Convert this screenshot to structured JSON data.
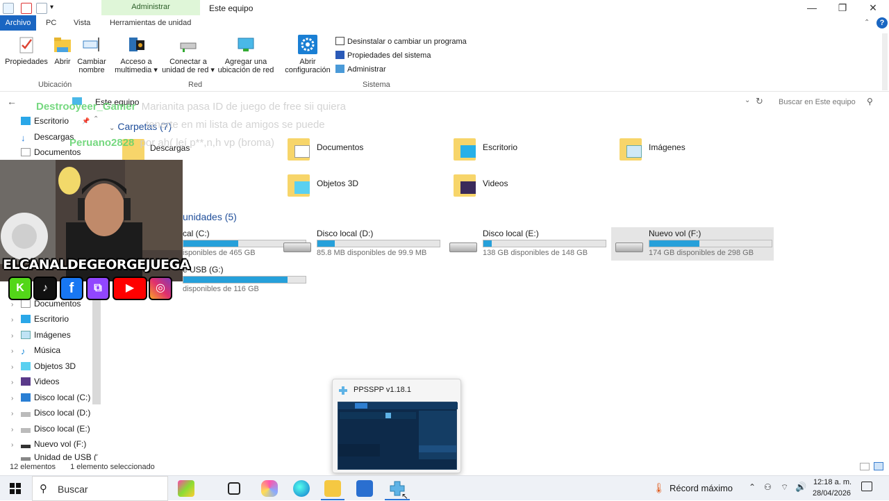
{
  "titlebar": {
    "context_tab": "Administrar",
    "window_title": "Este equipo",
    "buttons": [
      "—",
      "❐",
      "✕"
    ]
  },
  "tabs": {
    "file": "Archivo",
    "items": [
      "PC",
      "Vista",
      "Herramientas de unidad"
    ],
    "help": "?"
  },
  "ribbon": {
    "buttons": {
      "propiedades": "Propiedades",
      "abrir": "Abrir",
      "cambiar_nombre_1": "Cambiar",
      "cambiar_nombre_2": "nombre",
      "acceso_1": "Acceso a",
      "acceso_2": "multimedia ▾",
      "conectar_1": "Conectar a",
      "conectar_2": "unidad de red ▾",
      "agregar_1": "Agregar una",
      "agregar_2": "ubicación de red",
      "config_1": "Abrir",
      "config_2": "configuración"
    },
    "system_items": [
      "Desinstalar o cambiar un programa",
      "Propiedades del sistema",
      "Administrar"
    ],
    "groups": [
      "Ubicación",
      "Red",
      "Sistema"
    ]
  },
  "address": {
    "path": "Este equipo",
    "search_placeholder": "Buscar en Este equipo"
  },
  "nav": {
    "quick": [
      "Escritorio",
      "Descargas",
      "Documentos"
    ],
    "tree": [
      "Documentos",
      "Escritorio",
      "Imágenes",
      "Música",
      "Objetos 3D",
      "Videos",
      "Disco local (C:)",
      "Disco local (D:)",
      "Disco local (E:)",
      "Nuevo vol (F:)",
      "Unidad de USB ("
    ]
  },
  "content": {
    "folders_header": "Carpetas (7)",
    "folders": [
      "Descargas",
      "Documentos",
      "Escritorio",
      "Imágenes",
      "Objetos 3D",
      "Videos"
    ],
    "drives_header": "unidades (5)",
    "drives": [
      {
        "name": "cal (C:)",
        "free": "isponibles de 465 GB",
        "used": 0.45
      },
      {
        "name": "Disco local (D:)",
        "free": "85.8 MB disponibles de 99.9 MB",
        "used": 0.14
      },
      {
        "name": "Disco local (E:)",
        "free": "138 GB disponibles de 148 GB",
        "used": 0.07
      },
      {
        "name": "Nuevo vol (F:)",
        "free": "174 GB disponibles de 298 GB",
        "used": 0.41
      },
      {
        "name": "e USB (G:)",
        "free": "disponibles de 116 GB",
        "used": 0.85
      }
    ]
  },
  "status": {
    "count": "12 elementos",
    "selected": "1 elemento seleccionado"
  },
  "preview": {
    "title": "PPSSPP v1.18.1"
  },
  "taskbar": {
    "search": "Buscar",
    "weather": "Récord máximo",
    "time": "12:18 a. m.",
    "date": "28/04/2026"
  },
  "stream": {
    "channel": "ELCANALDEGEORGEJUEGA",
    "social": [
      "K",
      "♪",
      "f",
      "⧉",
      "▶",
      "◎"
    ],
    "chat": [
      {
        "user": "Destrooyeer_Gamer",
        "msg": "Marianita pasa ID de juego de free sii quiera"
      },
      {
        "user": "",
        "msg": "tenerte en mi lista de amigos se puede"
      },
      {
        "user": "Peruano2828",
        "msg": "por ah( leí p**,n,h vp (broma)"
      }
    ]
  },
  "colors": {
    "accent": "#1a66c2",
    "drive_fill": "#26a0da",
    "context_tab": "#dff6d8"
  }
}
